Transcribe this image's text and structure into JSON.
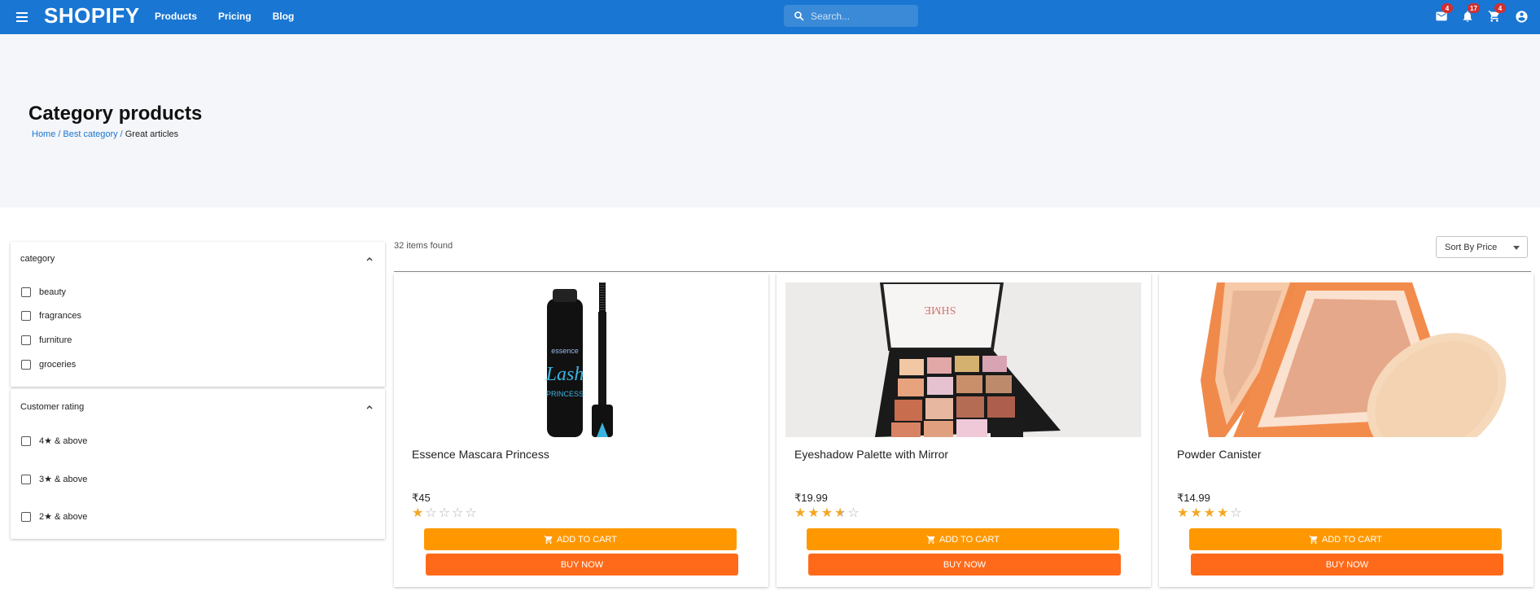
{
  "header": {
    "brand": "SHOPIFY",
    "nav": [
      "Products",
      "Pricing",
      "Blog"
    ],
    "search_placeholder": "Search...",
    "mail_badge": "4",
    "notifications_badge": "17",
    "cart_badge": "4",
    "color": "#1976d2"
  },
  "hero": {
    "title": "Category products",
    "breadcrumb": [
      "Home",
      "Best category",
      "Great articles"
    ],
    "separator": "/"
  },
  "filters": {
    "category": {
      "title": "category",
      "options": [
        "beauty",
        "fragrances",
        "furniture",
        "groceries"
      ]
    },
    "rating": {
      "title": "Customer rating",
      "options": [
        "4★ & above",
        "3★ & above",
        "2★ & above"
      ]
    }
  },
  "results": {
    "count_text": "32 items found",
    "sort_label": "Sort By Price"
  },
  "products": [
    {
      "title": "Essence Mascara Princess",
      "price": "₹45",
      "rating": 1,
      "cart_label": "ADD TO CART",
      "buy_label": "BUY NOW",
      "image": "mascara"
    },
    {
      "title": "Eyeshadow Palette with Mirror",
      "price": "₹19.99",
      "rating": 3.5,
      "cart_label": "ADD TO CART",
      "buy_label": "BUY NOW",
      "image": "eyeshadow-palette"
    },
    {
      "title": "Powder Canister",
      "price": "₹14.99",
      "rating": 4,
      "cart_label": "ADD TO CART",
      "buy_label": "BUY NOW",
      "image": "powder-compact"
    }
  ],
  "colors": {
    "star": "#f5a623",
    "add_to_cart": "#ff9800",
    "buy_now": "#ff6a1a"
  }
}
